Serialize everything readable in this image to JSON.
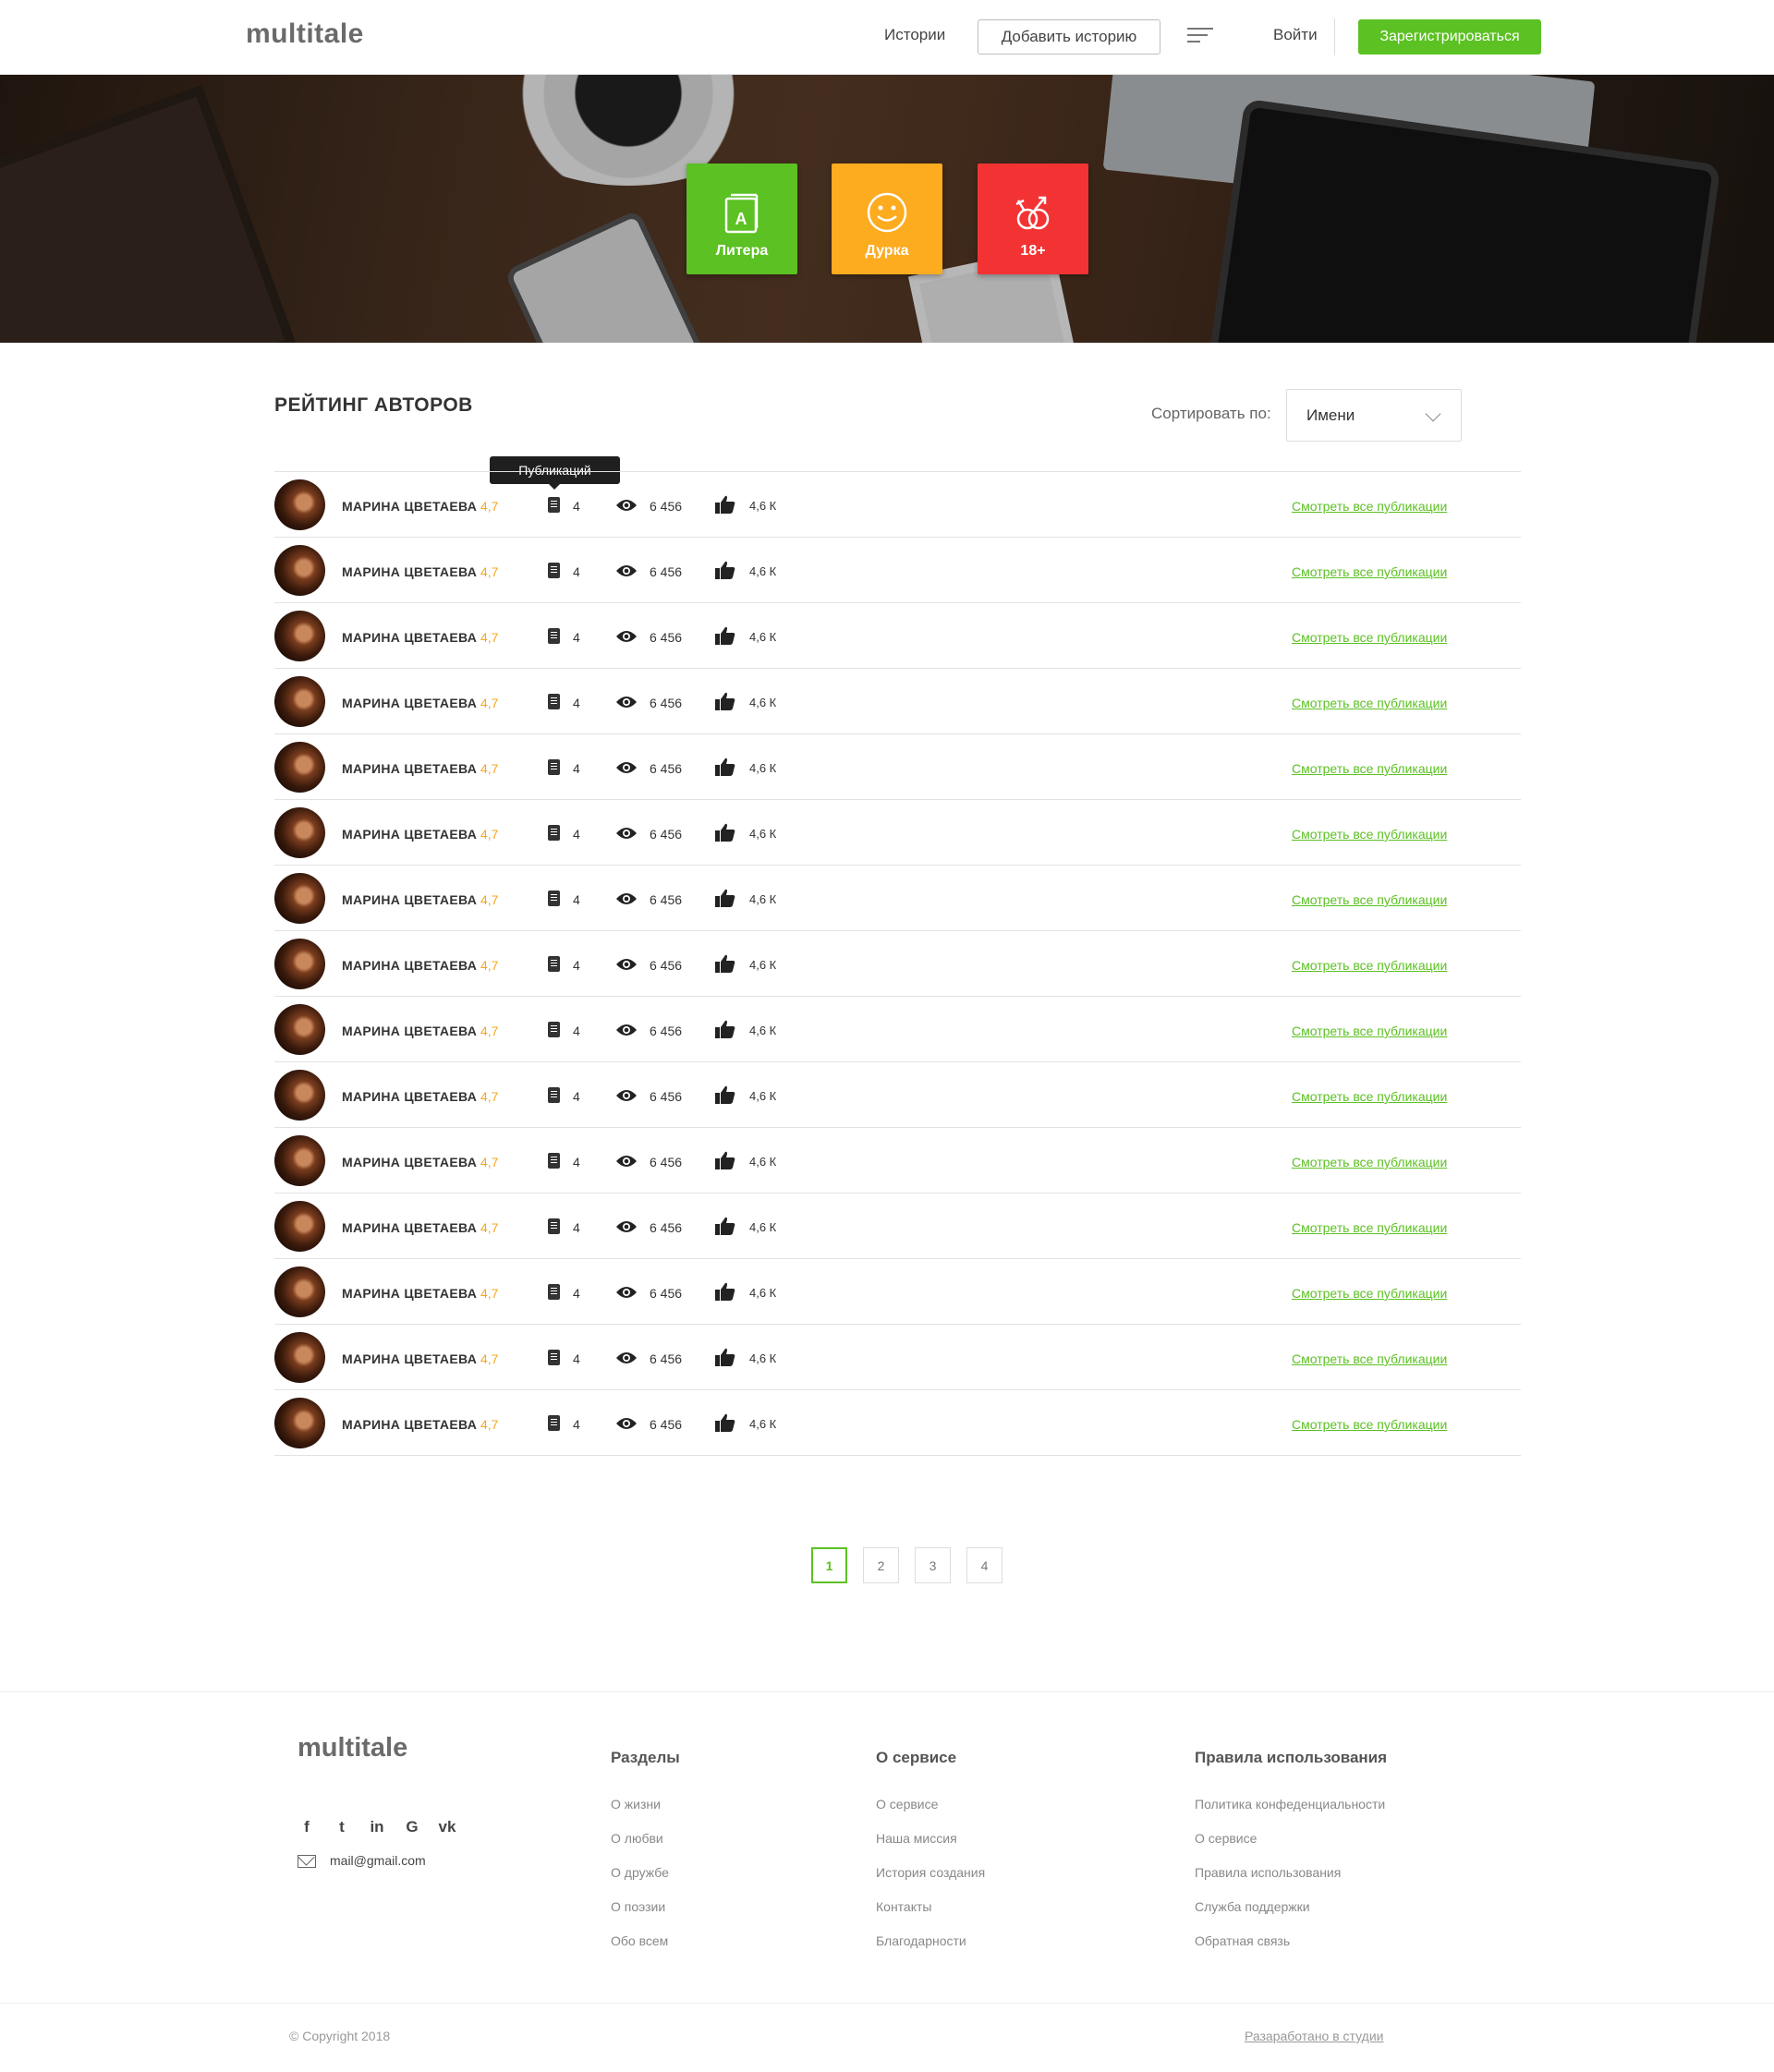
{
  "header": {
    "logo": "multitale",
    "nav_stories": "Истории",
    "add_story": "Добавить историю",
    "login": "Войти",
    "register": "Зарегистрироваться"
  },
  "categories": [
    {
      "label": "Литера",
      "color": "#5cc123",
      "icon": "book-icon"
    },
    {
      "label": "Дурка",
      "color": "#fdab1f",
      "icon": "smile-icon"
    },
    {
      "label": "18+",
      "color": "#f33333",
      "icon": "rings-icon"
    }
  ],
  "rating": {
    "title": "РЕЙТИНГ АВТОРОВ",
    "sort_label": "Сортировать по:",
    "sort_value": "Имени",
    "tooltip": "Публикаций",
    "rows": [
      {
        "name": "МАРИНА ЦВЕТАЕВА",
        "score": "4,7",
        "publications": "4",
        "views": "6 456",
        "likes": "4,6 К",
        "link": "Смотреть все публикации"
      },
      {
        "name": "МАРИНА ЦВЕТАЕВА",
        "score": "4,7",
        "publications": "4",
        "views": "6 456",
        "likes": "4,6 К",
        "link": "Смотреть все публикации"
      },
      {
        "name": "МАРИНА ЦВЕТАЕВА",
        "score": "4,7",
        "publications": "4",
        "views": "6 456",
        "likes": "4,6 К",
        "link": "Смотреть все публикации"
      },
      {
        "name": "МАРИНА ЦВЕТАЕВА",
        "score": "4,7",
        "publications": "4",
        "views": "6 456",
        "likes": "4,6 К",
        "link": "Смотреть все публикации"
      },
      {
        "name": "МАРИНА ЦВЕТАЕВА",
        "score": "4,7",
        "publications": "4",
        "views": "6 456",
        "likes": "4,6 К",
        "link": "Смотреть все публикации"
      },
      {
        "name": "МАРИНА ЦВЕТАЕВА",
        "score": "4,7",
        "publications": "4",
        "views": "6 456",
        "likes": "4,6 К",
        "link": "Смотреть все публикации"
      },
      {
        "name": "МАРИНА ЦВЕТАЕВА",
        "score": "4,7",
        "publications": "4",
        "views": "6 456",
        "likes": "4,6 К",
        "link": "Смотреть все публикации"
      },
      {
        "name": "МАРИНА ЦВЕТАЕВА",
        "score": "4,7",
        "publications": "4",
        "views": "6 456",
        "likes": "4,6 К",
        "link": "Смотреть все публикации"
      },
      {
        "name": "МАРИНА ЦВЕТАЕВА",
        "score": "4,7",
        "publications": "4",
        "views": "6 456",
        "likes": "4,6 К",
        "link": "Смотреть все публикации"
      },
      {
        "name": "МАРИНА ЦВЕТАЕВА",
        "score": "4,7",
        "publications": "4",
        "views": "6 456",
        "likes": "4,6 К",
        "link": "Смотреть все публикации"
      },
      {
        "name": "МАРИНА ЦВЕТАЕВА",
        "score": "4,7",
        "publications": "4",
        "views": "6 456",
        "likes": "4,6 К",
        "link": "Смотреть все публикации"
      },
      {
        "name": "МАРИНА ЦВЕТАЕВА",
        "score": "4,7",
        "publications": "4",
        "views": "6 456",
        "likes": "4,6 К",
        "link": "Смотреть все публикации"
      },
      {
        "name": "МАРИНА ЦВЕТАЕВА",
        "score": "4,7",
        "publications": "4",
        "views": "6 456",
        "likes": "4,6 К",
        "link": "Смотреть все публикации"
      },
      {
        "name": "МАРИНА ЦВЕТАЕВА",
        "score": "4,7",
        "publications": "4",
        "views": "6 456",
        "likes": "4,6 К",
        "link": "Смотреть все публикации"
      },
      {
        "name": "МАРИНА ЦВЕТАЕВА",
        "score": "4,7",
        "publications": "4",
        "views": "6 456",
        "likes": "4,6 К",
        "link": "Смотреть все публикации"
      }
    ]
  },
  "pagination": {
    "pages": [
      "1",
      "2",
      "3",
      "4"
    ],
    "active": "1"
  },
  "footer": {
    "logo": "multitale",
    "socials": [
      "f",
      "t",
      "in",
      "G",
      "vk"
    ],
    "email": "mail@gmail.com",
    "columns": [
      {
        "title": "Разделы",
        "links": [
          "О жизни",
          "О любви",
          "О дружбе",
          "О поэзии",
          "Обо всем"
        ]
      },
      {
        "title": "О сервисе",
        "links": [
          "О сервисе",
          "Наша миссия",
          "История создания",
          "Контакты",
          "Благодарности"
        ]
      },
      {
        "title": "Правила использования",
        "links": [
          "Политика конфеденциальности",
          "О сервисе",
          "Правила использования",
          "Служба поддержки",
          "Обратная связь"
        ]
      }
    ],
    "copyright": "© Copyright 2018",
    "developer": "Разаработано в студии"
  },
  "colors": {
    "accent": "#5cc123",
    "score": "#f5a623"
  }
}
